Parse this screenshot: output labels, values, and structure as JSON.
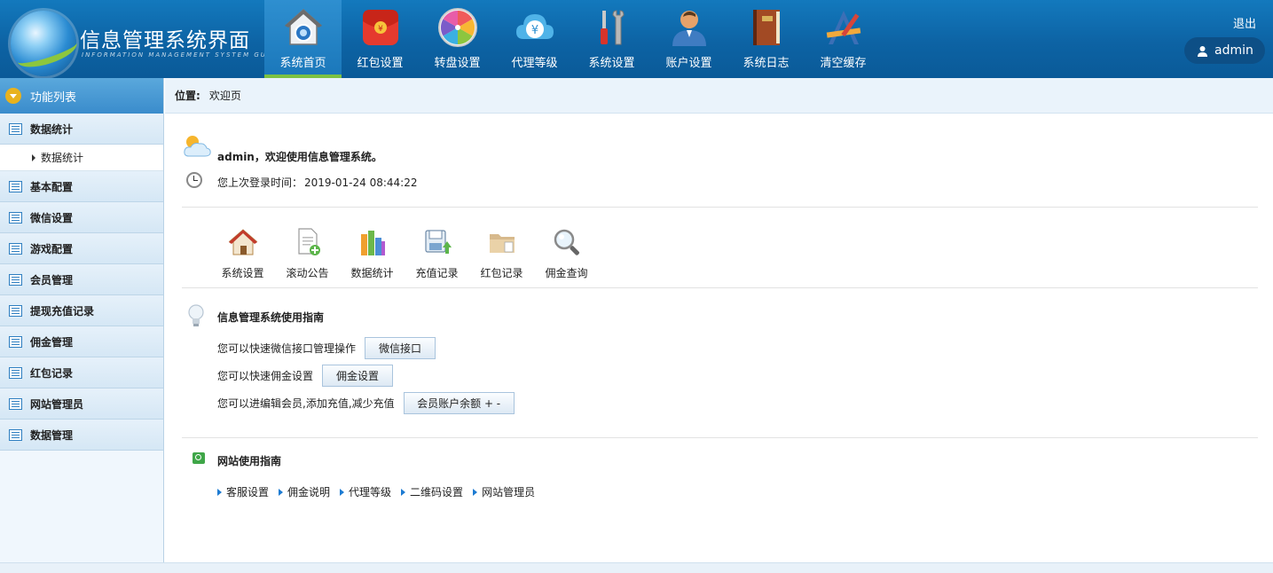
{
  "header": {
    "title": "信息管理系统界面",
    "subtitle": "INFORMATION MANAGEMENT SYSTEM GUI",
    "logout": "退出",
    "user": "admin",
    "nav": [
      {
        "label": "系统首页",
        "icon": "home-icon",
        "active": true
      },
      {
        "label": "红包设置",
        "icon": "red-envelope-icon"
      },
      {
        "label": "转盘设置",
        "icon": "wheel-icon"
      },
      {
        "label": "代理等级",
        "icon": "yen-cloud-icon"
      },
      {
        "label": "系统设置",
        "icon": "tools-icon"
      },
      {
        "label": "账户设置",
        "icon": "user-icon"
      },
      {
        "label": "系统日志",
        "icon": "book-icon"
      },
      {
        "label": "清空缓存",
        "icon": "design-tools-icon"
      }
    ]
  },
  "sidebar": {
    "title": "功能列表",
    "items": [
      {
        "label": "数据统计",
        "sub": [
          "数据统计"
        ]
      },
      {
        "label": "基本配置"
      },
      {
        "label": "微信设置"
      },
      {
        "label": "游戏配置"
      },
      {
        "label": "会员管理"
      },
      {
        "label": "提现充值记录"
      },
      {
        "label": "佣金管理"
      },
      {
        "label": "红包记录"
      },
      {
        "label": "网站管理员"
      },
      {
        "label": "数据管理"
      }
    ]
  },
  "breadcrumb": {
    "label": "位置:",
    "current": "欢迎页"
  },
  "main": {
    "welcome": "admin，欢迎使用信息管理系统。",
    "last_login_label": "您上次登录时间：",
    "last_login_time": "2019-01-24 08:44:22",
    "quick_links": [
      {
        "label": "系统设置",
        "icon": "house-icon"
      },
      {
        "label": "滚动公告",
        "icon": "document-add-icon"
      },
      {
        "label": "数据统计",
        "icon": "bar-chart-icon"
      },
      {
        "label": "充值记录",
        "icon": "save-upload-icon"
      },
      {
        "label": "红包记录",
        "icon": "folder-icon"
      },
      {
        "label": "佣金查询",
        "icon": "magnifier-icon"
      }
    ],
    "guide": {
      "title": "信息管理系统使用指南",
      "rows": [
        {
          "text": "您可以快速微信接口管理操作",
          "button": "微信接口"
        },
        {
          "text": "您可以快速佣金设置",
          "button": "佣金设置"
        },
        {
          "text": "您可以进编辑会员,添加充值,减少充值",
          "button": "会员账户余额 + -"
        }
      ]
    },
    "site_guide": {
      "title": "网站使用指南",
      "links": [
        "客服设置",
        "佣金说明",
        "代理等级",
        "二维码设置",
        "网站管理员"
      ]
    }
  },
  "colors": {
    "header_bg": "#0d63a4",
    "active_underline": "#7cc242",
    "sidebar_header": "#3a8ccc",
    "link_arrow": "#1d7bd2"
  }
}
